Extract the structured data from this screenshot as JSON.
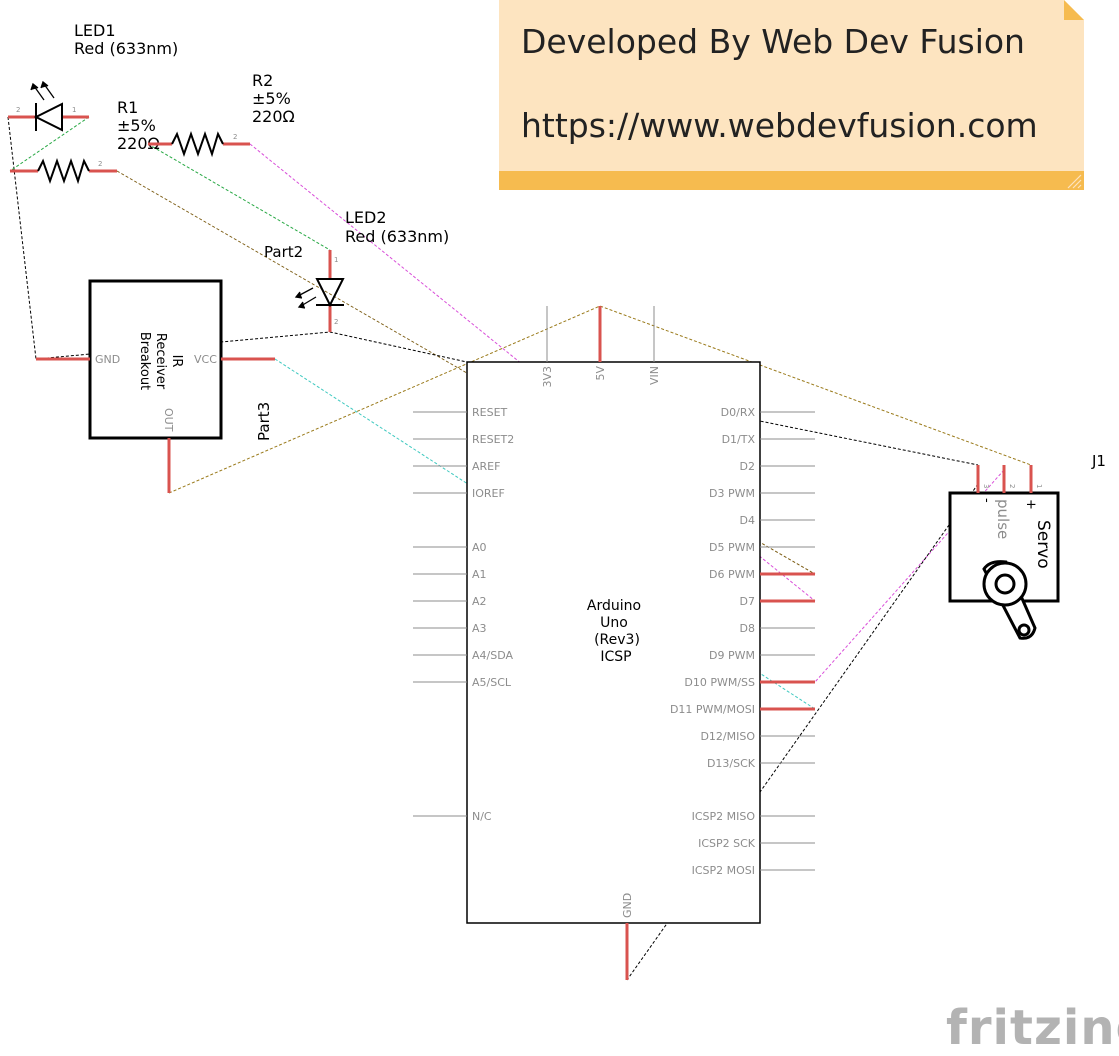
{
  "note": {
    "line1": "Developed By Web Dev Fusion",
    "line2": "https://www.webdevfusion.com",
    "fill": "#fde4c0",
    "band": "#f6bb4f"
  },
  "led1": {
    "name": "LED1",
    "value": "Red (633nm)",
    "pin2": "2",
    "pin1": "1"
  },
  "r1": {
    "name": "R1",
    "tolerance": "±5%",
    "value": "220Ω",
    "pin1": "1",
    "pin2": "2"
  },
  "r2": {
    "name": "R2",
    "tolerance": "±5%",
    "value": "220Ω",
    "pin1": "1",
    "pin2": "2"
  },
  "led2": {
    "name": "LED2",
    "value": "Red (633nm)",
    "part": "Part2",
    "pin1": "1",
    "pin2": "2"
  },
  "ir": {
    "line1": "IR",
    "line2": "Receiver",
    "line3": "Breakout",
    "gnd": "GND",
    "vcc": "VCC",
    "out": "OUT",
    "part": "Part3"
  },
  "arduino": {
    "name1": "Arduino",
    "name2": "Uno",
    "name3": "(Rev3)",
    "name4": "ICSP",
    "top_pins": [
      "3V3",
      "5V",
      "VIN"
    ],
    "bottom_pin": "GND",
    "left_pins": [
      "RESET",
      "RESET2",
      "AREF",
      "IOREF",
      "A0",
      "A1",
      "A2",
      "A3",
      "A4/SDA",
      "A5/SCL",
      "N/C"
    ],
    "right_pins": [
      "D0/RX",
      "D1/TX",
      "D2",
      "D3 PWM",
      "D4",
      "D5 PWM",
      "D6 PWM",
      "D7",
      "D8",
      "D9 PWM",
      "D10 PWM/SS",
      "D11 PWM/MOSI",
      "D12/MISO",
      "D13/SCK",
      "ICSP2 MISO",
      "ICSP2 SCK",
      "ICSP2 MOSI"
    ]
  },
  "servo": {
    "ref": "J1",
    "name": "Servo",
    "pulse": "pulse",
    "plus": "+",
    "minus": "-",
    "pin3": "3",
    "pin2": "2",
    "pin1": "1"
  },
  "logo": {
    "text": "fritzing",
    "color": "#b3b3b3"
  },
  "colors": {
    "pin_red": "#d9534f",
    "wire_black": "#000000",
    "wire_green": "#27a844",
    "wire_magenta": "#d94fd9",
    "wire_brown": "#7a5a10",
    "wire_olive": "#9a7a1a",
    "wire_cyan": "#3fc9c0"
  }
}
